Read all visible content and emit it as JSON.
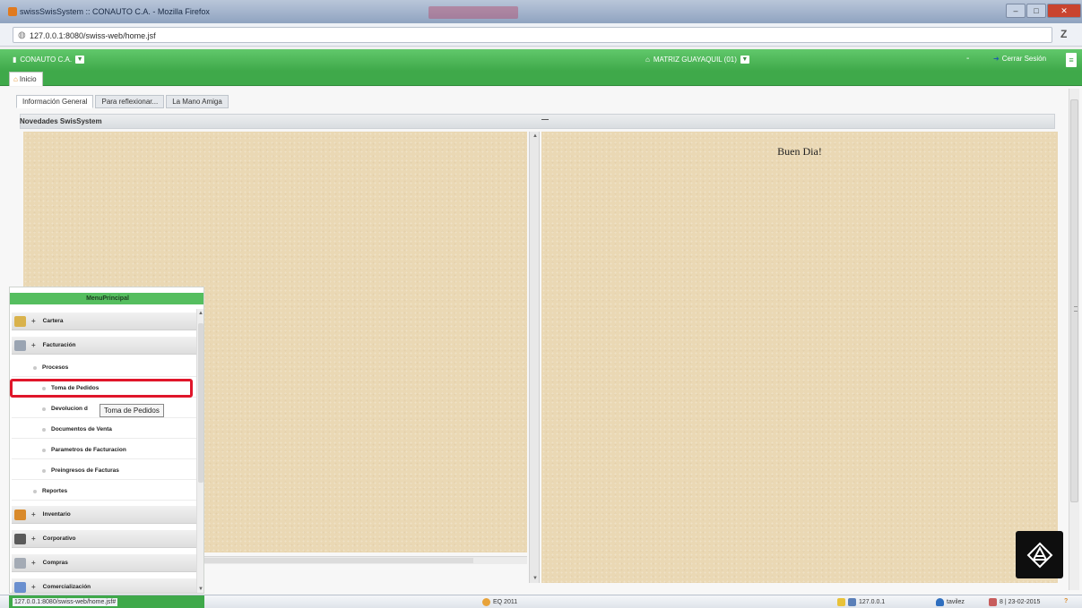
{
  "window": {
    "title": "swissSwisSystem :: CONAUTO C.A. - Mozilla Firefox",
    "controls": [
      "–",
      "□",
      "✕"
    ]
  },
  "address_bar": {
    "url": "127.0.0.1:8080/swiss-web/home.jsf",
    "extra_button": "Z"
  },
  "app_header": {
    "company": "CONAUTO C.A.",
    "branch": "MATRIZ GUAYAQUIL (01)",
    "separator": "-",
    "logout_label": "Cerrar Sesión",
    "home_tab": "Inicio"
  },
  "tabs": [
    "Información General",
    "Para reflexionar...",
    "La Mano Amiga"
  ],
  "panel": {
    "left_title": "Novedades SwisSystem",
    "greeting": "Buen Dia!"
  },
  "menu": {
    "title": "MenuPrincipal",
    "groups": [
      {
        "label": "Cartera",
        "icon": "wallet-icon",
        "color": "#d9b24c"
      },
      {
        "label": "Facturación",
        "icon": "document-icon",
        "color": "#9aa4b2"
      }
    ],
    "facturacion_items": {
      "procesos": "Procesos",
      "toma": "Toma de Pedidos",
      "devolucion": "Devolucion d",
      "documentos": "Documentos de Venta",
      "parametros": "Parametros de Facturacion",
      "preingresos": "Preingresos de Facturas",
      "reportes": "Reportes"
    },
    "groups_after": [
      {
        "label": "Inventario",
        "icon": "boxes-icon",
        "color": "#d98a2b"
      },
      {
        "label": "Corporativo",
        "icon": "person-icon",
        "color": "#5a5a5a"
      },
      {
        "label": "Compras",
        "icon": "cart-icon",
        "color": "#a4abb5"
      },
      {
        "label": "Comercialización",
        "icon": "chart-icon",
        "color": "#6a8fcf"
      }
    ],
    "plus_sign": "+"
  },
  "tooltip": "Toma de Pedidos",
  "statusbar": {
    "url": "127.0.0.1:8080/swiss-web/home.jsf#",
    "company_code": "EQ 2011",
    "ip": "127.0.0.1",
    "user": "tavilez",
    "date": "8 | 23-02-2015",
    "help": "?"
  },
  "colors": {
    "accent_green": "#3fa94a",
    "selection_red": "#e0162a",
    "parchment": "#ead8b4"
  }
}
